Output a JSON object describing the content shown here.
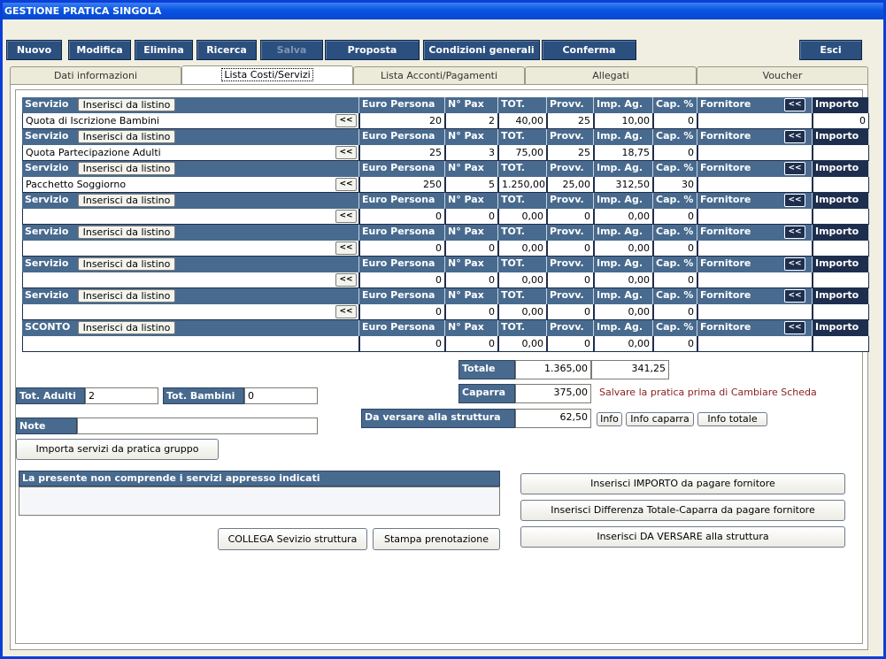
{
  "window": {
    "title": "GESTIONE PRATICA SINGOLA"
  },
  "toolbar": {
    "nuovo": "Nuovo",
    "modifica": "Modifica",
    "elimina": "Elimina",
    "ricerca": "Ricerca",
    "salva": "Salva",
    "proposta": "Proposta",
    "condizioni": "Condizioni generali",
    "conferma": "Conferma",
    "esci": "Esci"
  },
  "tabs": [
    "Dati informazioni",
    "Lista Costi/Servizi",
    "Lista Acconti/Pagamenti",
    "Allegati",
    "Voucher"
  ],
  "headers": {
    "servizio": "Servizio",
    "sconto": "SCONTO",
    "inserisci": "Inserisci da listino",
    "euro": "Euro Persona",
    "pax": "N° Pax",
    "tot": "TOT.",
    "provv": "Provv.",
    "impag": "Imp. Ag.",
    "cap": "Cap. %",
    "fornitore": "Fornitore",
    "arrow": "<<",
    "importo": "Importo"
  },
  "rows": [
    {
      "name": "Quota di Iscrizione Bambini",
      "euro": "20",
      "pax": "2",
      "tot": "40,00",
      "provv": "25",
      "impag": "10,00",
      "cap": "0",
      "fornitore": "",
      "importo": "0"
    },
    {
      "name": "Quota Partecipazione Adulti",
      "euro": "25",
      "pax": "3",
      "tot": "75,00",
      "provv": "25",
      "impag": "18,75",
      "cap": "0",
      "fornitore": "",
      "importo": ""
    },
    {
      "name": "Pacchetto Soggiorno",
      "euro": "250",
      "pax": "5",
      "tot": "1.250,00",
      "provv": "25,00",
      "impag": "312,50",
      "cap": "30",
      "fornitore": "",
      "importo": ""
    },
    {
      "name": "",
      "euro": "0",
      "pax": "0",
      "tot": "0,00",
      "provv": "0",
      "impag": "0,00",
      "cap": "0",
      "fornitore": "",
      "importo": ""
    },
    {
      "name": "",
      "euro": "0",
      "pax": "0",
      "tot": "0,00",
      "provv": "0",
      "impag": "0,00",
      "cap": "0",
      "fornitore": "",
      "importo": ""
    },
    {
      "name": "",
      "euro": "0",
      "pax": "0",
      "tot": "0,00",
      "provv": "0",
      "impag": "0,00",
      "cap": "0",
      "fornitore": "",
      "importo": ""
    },
    {
      "name": "",
      "euro": "0",
      "pax": "0",
      "tot": "0,00",
      "provv": "0",
      "impag": "0,00",
      "cap": "0",
      "fornitore": "",
      "importo": ""
    },
    {
      "name": "",
      "euro": "0",
      "pax": "0",
      "tot": "0,00",
      "provv": "0",
      "impag": "0,00",
      "cap": "0",
      "fornitore": "",
      "importo": ""
    }
  ],
  "totals": {
    "totale_label": "Totale",
    "totale": "1.365,00",
    "totale_ag": "341,25",
    "caparra_label": "Caparra",
    "caparra": "375,00",
    "warning": "Salvare la pratica prima di Cambiare Scheda",
    "versare_label": "Da versare alla struttura",
    "versare": "62,50",
    "info": "Info",
    "info_caparra": "Info caparra",
    "info_totale": "Info totale"
  },
  "pax": {
    "adulti_label": "Tot. Adulti",
    "adulti": "2",
    "bambini_label": "Tot. Bambini",
    "bambini": "0",
    "note_label": "Note",
    "note": ""
  },
  "actions": {
    "importa": "Importa servizi da pratica gruppo",
    "non_comprende": "La presente non comprende i servizi appresso indicati",
    "collega": "COLLEGA Sevizio struttura",
    "stampa": "Stampa prenotazione",
    "ins_importo": "Inserisci IMPORTO da pagare fornitore",
    "ins_diff": "Inserisci Differenza Totale-Caparra da pagare fornitore",
    "ins_versare": "Inserisci DA VERSARE alla struttura"
  },
  "colors": {
    "header": "#486a8e",
    "header_dark": "#1e2e4e",
    "title_blue": "#0a54e3"
  }
}
